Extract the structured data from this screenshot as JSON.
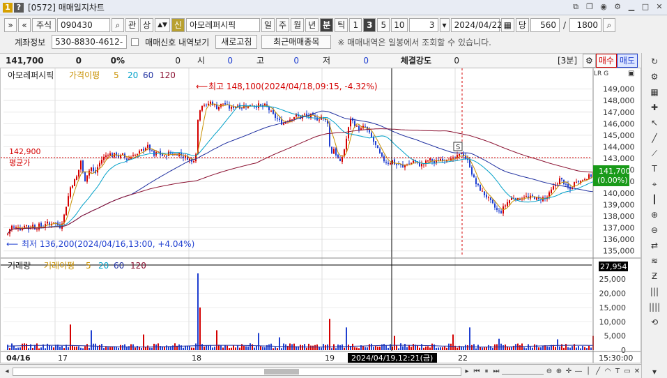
{
  "titlebar": {
    "num": "1",
    "help": "?",
    "title": "[0572] 매매일지차트"
  },
  "toolbar1": {
    "market": "주식",
    "code": "090430",
    "btn_gwan": "관",
    "btn_sang": "상",
    "new_flag": "신",
    "stock_name": "아모레퍼시픽",
    "periods": [
      "일",
      "주",
      "월",
      "년",
      "분",
      "틱"
    ],
    "selected_period": "분",
    "intervals": [
      "1",
      "3",
      "5",
      "10"
    ],
    "selected_interval": "3",
    "count_value": "3",
    "date": "2024/04/22",
    "dang": "당",
    "visible_count": "560",
    "total_count": "1800"
  },
  "toolbar2": {
    "account_label": "계좌정보",
    "account_no": "530-8830-4612-",
    "signal_label": "매매신호 내역보기",
    "refresh_button": "새로고침",
    "recent_button": "최근매매종목",
    "notice": "※ 매매내역은 일봉에서 조회할 수 있습니다."
  },
  "quote": {
    "price": "141,700",
    "change": "0",
    "change_pct": "0%",
    "volume": "0",
    "open_label": "시",
    "open": "0",
    "high_label": "고",
    "high": "0",
    "low_label": "저",
    "low": "0",
    "strength_label": "체결강도",
    "strength": "0",
    "timeframe": "[3분]",
    "buy_button": "매수",
    "sell_button": "매도"
  },
  "legend_price": {
    "name": "아모레퍼시픽",
    "ma_label": "가격이평",
    "ma_periods": [
      "5",
      "20",
      "60",
      "120"
    ]
  },
  "legend_volume": {
    "name": "거래량",
    "ma_label": "거래이평",
    "ma_periods": [
      "5",
      "20",
      "60",
      "120"
    ]
  },
  "annotations": {
    "high_label": "최고 148,100(2024/04/18,09:15, -4.32%)",
    "low_label": "최저 136,200(2024/04/16,13:00, +4.04%)",
    "avg_price": "142,900",
    "avg_label": "평균가",
    "current_price": "141,700",
    "current_pct": "(0.00%)",
    "current_volume": "27,954",
    "cursor_time": "2024/04/19,12:21(금)",
    "end_time": "15:30:00",
    "signal_marker": "S"
  },
  "colors": {
    "up": "#d40000",
    "down": "#1f3fd0",
    "ma5": "#c89000",
    "ma20": "#00a0c8",
    "ma60": "#2030a0",
    "ma120": "#8a1030",
    "accent_red": "#d40000",
    "current_bg": "#1a9a1a"
  },
  "axis": {
    "price_ticks": [
      "149,000",
      "148,000",
      "147,000",
      "146,000",
      "145,000",
      "144,000",
      "143,000",
      "142,000",
      "141,000",
      "140,000",
      "139,000",
      "138,000",
      "137,000",
      "136,000",
      "135,000"
    ],
    "volume_ticks": [
      "25,000",
      "20,000",
      "15,000",
      "10,000",
      "5,000",
      "0"
    ],
    "x_labels": [
      "04/16",
      "17",
      "18",
      "19",
      "22"
    ]
  },
  "chart_data": {
    "type": "candlestick",
    "timeframe": "3분",
    "ylim": [
      134500,
      149700
    ],
    "volume_ylim": [
      0,
      27000
    ],
    "points": [
      [
        0,
        136.5
      ],
      [
        5,
        137.2
      ],
      [
        10,
        136.9
      ],
      [
        15,
        137.1
      ],
      [
        20,
        136.8
      ],
      [
        25,
        137.4
      ],
      [
        30,
        136.9
      ],
      [
        35,
        137.3
      ],
      [
        40,
        136.9
      ],
      [
        45,
        137.2
      ],
      [
        50,
        137.0
      ],
      [
        55,
        137.5
      ],
      [
        60,
        137.2
      ],
      [
        65,
        137.6
      ],
      [
        70,
        137.3
      ],
      [
        75,
        137.1
      ],
      [
        80,
        137.8
      ],
      [
        85,
        139.2
      ],
      [
        90,
        140.5
      ],
      [
        95,
        141.0
      ],
      [
        100,
        141.5
      ],
      [
        105,
        142.8
      ],
      [
        110,
        141.0
      ],
      [
        115,
        141.8
      ],
      [
        120,
        142.2
      ],
      [
        125,
        141.6
      ],
      [
        130,
        142.4
      ],
      [
        135,
        142.9
      ],
      [
        140,
        143.2
      ],
      [
        145,
        143.5
      ],
      [
        150,
        143.2
      ],
      [
        155,
        143.4
      ],
      [
        160,
        143.1
      ],
      [
        165,
        143.3
      ],
      [
        170,
        142.9
      ],
      [
        175,
        143.0
      ],
      [
        180,
        143.4
      ],
      [
        185,
        143.2
      ],
      [
        190,
        143.6
      ],
      [
        195,
        143.8
      ],
      [
        200,
        144.1
      ],
      [
        205,
        143.7
      ],
      [
        210,
        143.2
      ],
      [
        215,
        143.6
      ],
      [
        220,
        143.3
      ],
      [
        225,
        143.1
      ],
      [
        230,
        143.5
      ],
      [
        235,
        143.4
      ],
      [
        240,
        143.3
      ],
      [
        245,
        143.5
      ],
      [
        250,
        143.2
      ],
      [
        255,
        143.1
      ],
      [
        260,
        143.0
      ],
      [
        265,
        142.6
      ],
      [
        270,
        143.5
      ],
      [
        272,
        146.0
      ],
      [
        276,
        147.3
      ],
      [
        280,
        147.8
      ],
      [
        285,
        147.5
      ],
      [
        290,
        147.9
      ],
      [
        295,
        147.7
      ],
      [
        300,
        147.4
      ],
      [
        305,
        147.6
      ],
      [
        310,
        147.8
      ],
      [
        315,
        147.5
      ],
      [
        320,
        147.3
      ],
      [
        325,
        147.5
      ],
      [
        330,
        147.6
      ],
      [
        335,
        147.4
      ],
      [
        340,
        147.6
      ],
      [
        345,
        147.5
      ],
      [
        350,
        147.7
      ],
      [
        355,
        147.5
      ],
      [
        360,
        147.6
      ],
      [
        365,
        147.4
      ],
      [
        370,
        147.6
      ],
      [
        375,
        147.2
      ],
      [
        380,
        146.8
      ],
      [
        385,
        146.5
      ],
      [
        390,
        146.2
      ],
      [
        395,
        146.0
      ],
      [
        400,
        146.3
      ],
      [
        405,
        146.4
      ],
      [
        410,
        146.6
      ],
      [
        415,
        146.7
      ],
      [
        420,
        146.5
      ],
      [
        425,
        146.8
      ],
      [
        430,
        146.6
      ],
      [
        435,
        146.7
      ],
      [
        440,
        146.5
      ],
      [
        445,
        146.4
      ],
      [
        450,
        146.6
      ],
      [
        455,
        146.3
      ],
      [
        460,
        146.1
      ],
      [
        463,
        143.0
      ],
      [
        467,
        144.0
      ],
      [
        472,
        143.2
      ],
      [
        477,
        142.6
      ],
      [
        482,
        143.5
      ],
      [
        487,
        145.0
      ],
      [
        492,
        146.5
      ],
      [
        497,
        146.0
      ],
      [
        502,
        145.6
      ],
      [
        507,
        145.5
      ],
      [
        512,
        145.8
      ],
      [
        517,
        145.3
      ],
      [
        522,
        144.8
      ],
      [
        527,
        144.2
      ],
      [
        532,
        143.6
      ],
      [
        537,
        143.0
      ],
      [
        542,
        142.7
      ],
      [
        547,
        142.6
      ],
      [
        552,
        142.8
      ],
      [
        557,
        142.4
      ],
      [
        562,
        142.5
      ],
      [
        567,
        142.2
      ],
      [
        572,
        142.6
      ],
      [
        577,
        142.5
      ],
      [
        582,
        142.8
      ],
      [
        587,
        142.6
      ],
      [
        592,
        142.4
      ],
      [
        597,
        142.5
      ],
      [
        602,
        142.8
      ],
      [
        607,
        142.9
      ],
      [
        612,
        142.6
      ],
      [
        617,
        142.8
      ],
      [
        622,
        143.0
      ],
      [
        627,
        142.9
      ],
      [
        632,
        143.1
      ],
      [
        637,
        142.8
      ],
      [
        642,
        143.0
      ],
      [
        647,
        143.2
      ],
      [
        652,
        143.5
      ],
      [
        657,
        143.0
      ],
      [
        662,
        142.6
      ],
      [
        667,
        141.5
      ],
      [
        672,
        140.8
      ],
      [
        677,
        140.4
      ],
      [
        682,
        140.0
      ],
      [
        687,
        139.7
      ],
      [
        692,
        139.3
      ],
      [
        697,
        138.9
      ],
      [
        702,
        138.5
      ],
      [
        707,
        138.3
      ],
      [
        712,
        138.8
      ],
      [
        717,
        139.2
      ],
      [
        722,
        139.5
      ],
      [
        727,
        139.7
      ],
      [
        732,
        139.4
      ],
      [
        737,
        139.6
      ],
      [
        742,
        139.8
      ],
      [
        747,
        139.5
      ],
      [
        752,
        139.7
      ],
      [
        757,
        139.6
      ],
      [
        762,
        139.4
      ],
      [
        767,
        139.6
      ],
      [
        772,
        139.5
      ],
      [
        777,
        139.9
      ],
      [
        782,
        140.4
      ],
      [
        787,
        140.8
      ],
      [
        792,
        141.2
      ],
      [
        797,
        141.0
      ],
      [
        802,
        140.5
      ],
      [
        807,
        140.3
      ],
      [
        812,
        140.8
      ],
      [
        817,
        141.2
      ],
      [
        822,
        141.0
      ],
      [
        827,
        141.3
      ],
      [
        832,
        141.4
      ],
      [
        837,
        141.5
      ],
      [
        840,
        141.7
      ]
    ],
    "volume_spikes": [
      [
        90,
        9000
      ],
      [
        120,
        7000
      ],
      [
        195,
        5500
      ],
      [
        272,
        27000
      ],
      [
        276,
        15000
      ],
      [
        300,
        7000
      ],
      [
        360,
        6000
      ],
      [
        390,
        4500
      ],
      [
        463,
        11000
      ],
      [
        487,
        8000
      ],
      [
        555,
        5000
      ],
      [
        640,
        5500
      ],
      [
        662,
        8000
      ],
      [
        705,
        4000
      ],
      [
        790,
        3800
      ],
      [
        840,
        5000
      ]
    ]
  }
}
